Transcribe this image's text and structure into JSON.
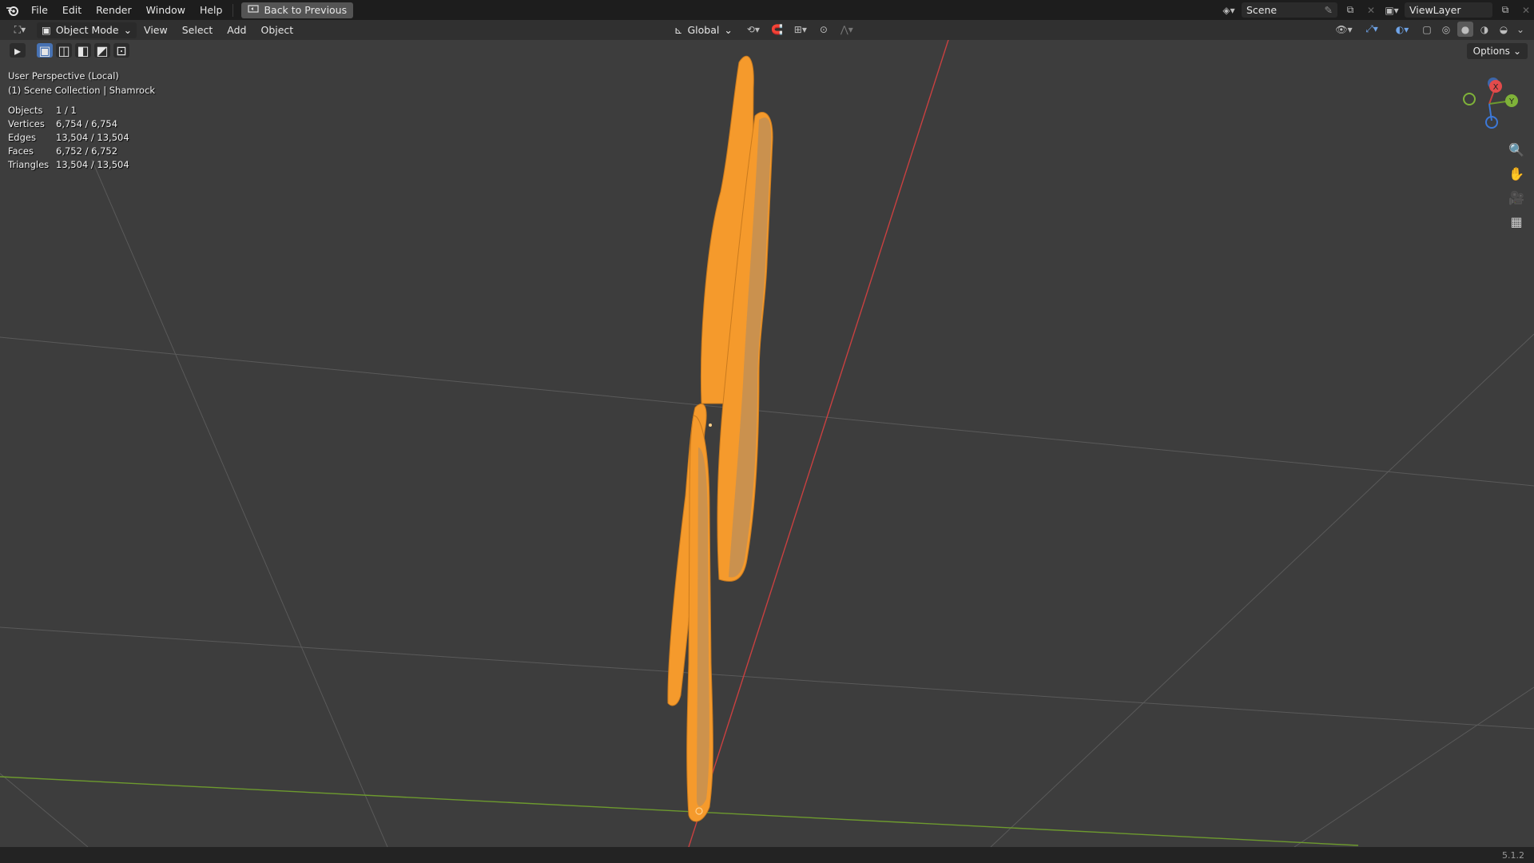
{
  "menu": {
    "items": [
      "File",
      "Edit",
      "Render",
      "Window",
      "Help"
    ],
    "back_label": "Back to Previous"
  },
  "topright": {
    "scene_label": "Scene",
    "viewlayer_label": "ViewLayer"
  },
  "header": {
    "mode_label": "Object Mode",
    "menus": [
      "View",
      "Select",
      "Add",
      "Object"
    ],
    "transform_label": "Global"
  },
  "viewport": {
    "perspective": "User Perspective (Local)",
    "collection": "(1) Scene Collection | Shamrock",
    "options_label": "Options",
    "stats": [
      {
        "label": "Objects",
        "value": "1 / 1"
      },
      {
        "label": "Vertices",
        "value": "6,754 / 6,754"
      },
      {
        "label": "Edges",
        "value": "13,504 / 13,504"
      },
      {
        "label": "Faces",
        "value": "6,752 / 6,752"
      },
      {
        "label": "Triangles",
        "value": "13,504 / 13,504"
      }
    ],
    "gizmo": {
      "x": "X",
      "y": "Y"
    }
  },
  "status": {
    "version": "5.1.2"
  },
  "colors": {
    "accent": "#4772b3",
    "selection": "#ffa030",
    "x_axis": "#e34b4b",
    "y_axis": "#7fb239",
    "z_axis": "#3c78d8"
  }
}
